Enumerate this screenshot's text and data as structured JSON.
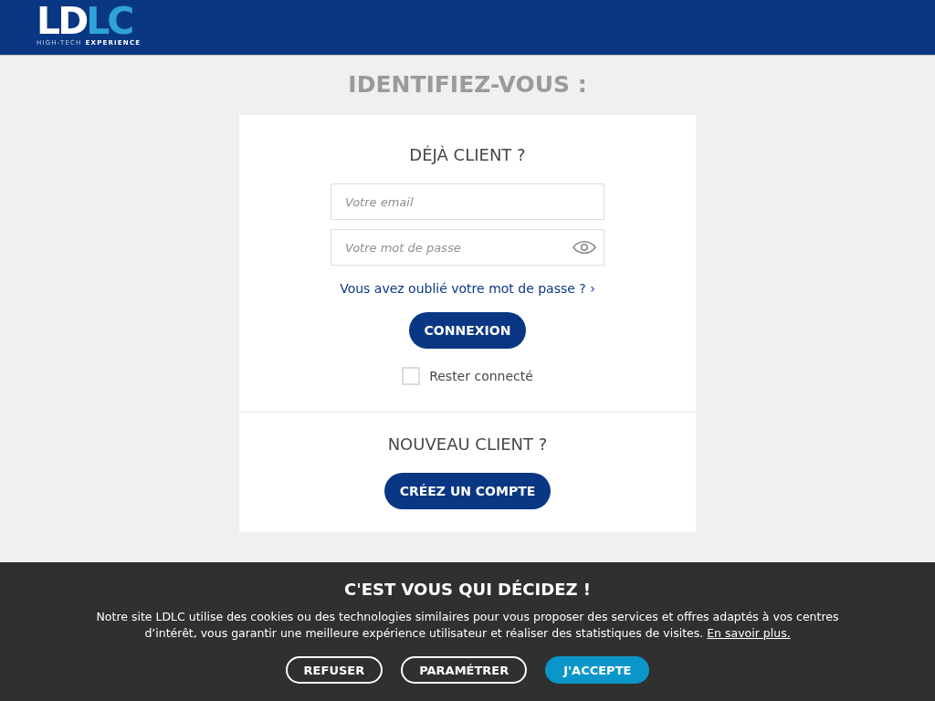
{
  "header": {
    "logo": {
      "wordmark": [
        {
          "text": "LD"
        },
        {
          "text": "LC"
        }
      ],
      "tagline": [
        {
          "text": "HIGH-TECH"
        },
        {
          "text": "EXPERIENCE"
        }
      ]
    }
  },
  "page_title": "IDENTIFIEZ-VOUS :",
  "existing_customer": {
    "heading": "DÉJÀ CLIENT ?",
    "email_field": {
      "placeholder": "Votre email"
    },
    "password_field": {
      "placeholder": "Votre mot de passe"
    },
    "forgot_link": "Vous avez oublié votre mot de passe ? ›",
    "login_button": "CONNEXION",
    "remember_me": {
      "label": "Rester connecté",
      "checked": false
    }
  },
  "new_customer": {
    "heading": "NOUVEAU CLIENT ?",
    "create_button": "CRÉEZ UN COMPTE"
  },
  "cookie_banner": {
    "title": "C'EST VOUS QUI DÉCIDEZ !",
    "text": "Notre site LDLC utilise des cookies ou des technologies similaires pour vous proposer des services et offres adaptés à vos centres d’intérêt, vous garantir une meilleure expérience utilisateur et réaliser des statistiques de visites.",
    "link": "En savoir plus.",
    "buttons": [
      {
        "label": "REFUSER",
        "kind": "outline"
      },
      {
        "label": "PARAMÉTRER",
        "kind": "outline"
      },
      {
        "label": "J'ACCEPTE",
        "kind": "filled"
      }
    ]
  }
}
